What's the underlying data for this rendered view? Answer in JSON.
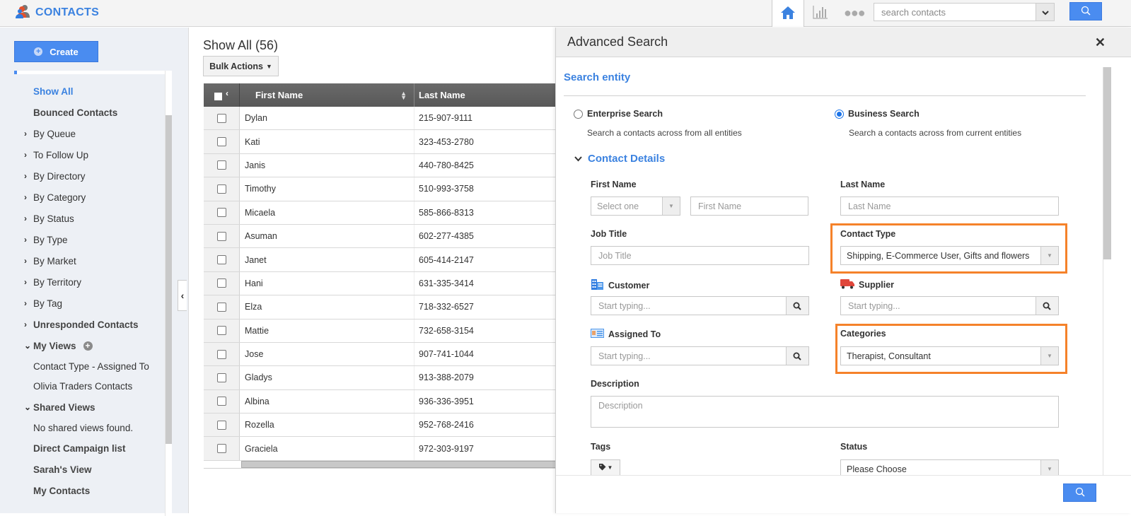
{
  "app": {
    "title": "CONTACTS",
    "logo_icon": "contacts-people-icon",
    "nav": [
      {
        "name": "home",
        "icon": "home-icon",
        "active": true
      },
      {
        "name": "reports",
        "icon": "bar-chart-icon",
        "active": false
      },
      {
        "name": "more",
        "icon": "more-dots-icon",
        "glyph": "●●●",
        "active": false
      }
    ],
    "search": {
      "placeholder": "search contacts",
      "value": ""
    }
  },
  "sidebar": {
    "create_label": "Create",
    "items": [
      {
        "label": "Show All",
        "type": "link",
        "active": true
      },
      {
        "label": "Bounced Contacts",
        "type": "link"
      },
      {
        "label": "By Queue",
        "type": "group",
        "expanded": false
      },
      {
        "label": "To Follow Up",
        "type": "group",
        "expanded": false
      },
      {
        "label": "By Directory",
        "type": "group",
        "expanded": false
      },
      {
        "label": "By Category",
        "type": "group",
        "expanded": false
      },
      {
        "label": "By Status",
        "type": "group",
        "expanded": false
      },
      {
        "label": "By Type",
        "type": "group",
        "expanded": false
      },
      {
        "label": "By Market",
        "type": "group",
        "expanded": false
      },
      {
        "label": "By Territory",
        "type": "group",
        "expanded": false
      },
      {
        "label": "By Tag",
        "type": "group",
        "expanded": false
      },
      {
        "label": "Unresponded Contacts",
        "type": "group",
        "expanded": false
      },
      {
        "label": "My Views",
        "type": "group",
        "expanded": true
      },
      {
        "label": "Contact Type - Assigned To",
        "type": "subitem"
      },
      {
        "label": "Olivia Traders Contacts",
        "type": "subitem"
      },
      {
        "label": "Shared Views",
        "type": "group",
        "expanded": true
      },
      {
        "label": "No shared views found.",
        "type": "note"
      },
      {
        "label": "Direct Campaign list",
        "type": "bold"
      },
      {
        "label": "Sarah's View",
        "type": "bold"
      },
      {
        "label": "My Contacts",
        "type": "bold"
      }
    ]
  },
  "main": {
    "title": "Show All (56)",
    "bulk_actions_label": "Bulk Actions",
    "columns": [
      "First Name",
      "Last Name"
    ],
    "rows": [
      {
        "first": "Dylan",
        "last": "215-907-9111"
      },
      {
        "first": "Kati",
        "last": "323-453-2780"
      },
      {
        "first": "Janis",
        "last": "440-780-8425"
      },
      {
        "first": "Timothy",
        "last": "510-993-3758"
      },
      {
        "first": "Micaela",
        "last": "585-866-8313"
      },
      {
        "first": "Asuman",
        "last": "602-277-4385"
      },
      {
        "first": "Janet",
        "last": "605-414-2147"
      },
      {
        "first": "Hani",
        "last": "631-335-3414"
      },
      {
        "first": "Elza",
        "last": "718-332-6527"
      },
      {
        "first": "Mattie",
        "last": "732-658-3154"
      },
      {
        "first": "Jose",
        "last": "907-741-1044"
      },
      {
        "first": "Gladys",
        "last": "913-388-2079"
      },
      {
        "first": "Albina",
        "last": "936-336-3951"
      },
      {
        "first": "Rozella",
        "last": "952-768-2416"
      },
      {
        "first": "Graciela",
        "last": "972-303-9197"
      }
    ]
  },
  "advanced_search": {
    "title": "Advanced Search",
    "section_title": "Search entity",
    "options": [
      {
        "label": "Enterprise Search",
        "desc": "Search a contacts across from all entities",
        "selected": false
      },
      {
        "label": "Business Search",
        "desc": "Search a contacts across from current entities",
        "selected": true
      }
    ],
    "contact_details_title": "Contact Details",
    "fields": {
      "first_name": {
        "label": "First Name",
        "select_placeholder": "Select one",
        "placeholder": "First Name"
      },
      "last_name": {
        "label": "Last Name",
        "placeholder": "Last Name"
      },
      "job_title": {
        "label": "Job Title",
        "placeholder": "Job Title"
      },
      "contact_type": {
        "label": "Contact Type",
        "value": "Shipping, E-Commerce User, Gifts and flowers",
        "highlighted": true
      },
      "customer": {
        "label": "Customer",
        "placeholder": "Start typing..."
      },
      "supplier": {
        "label": "Supplier",
        "placeholder": "Start typing..."
      },
      "assigned_to": {
        "label": "Assigned To",
        "placeholder": "Start typing..."
      },
      "categories": {
        "label": "Categories",
        "value": "Therapist, Consultant",
        "highlighted": true
      },
      "description": {
        "label": "Description",
        "placeholder": "Description"
      },
      "tags": {
        "label": "Tags"
      },
      "status": {
        "label": "Status",
        "value": "Please Choose"
      }
    },
    "highlight_color": "#f5822a"
  },
  "colors": {
    "accent": "#3b82e0",
    "button": "#4a8cf0"
  }
}
